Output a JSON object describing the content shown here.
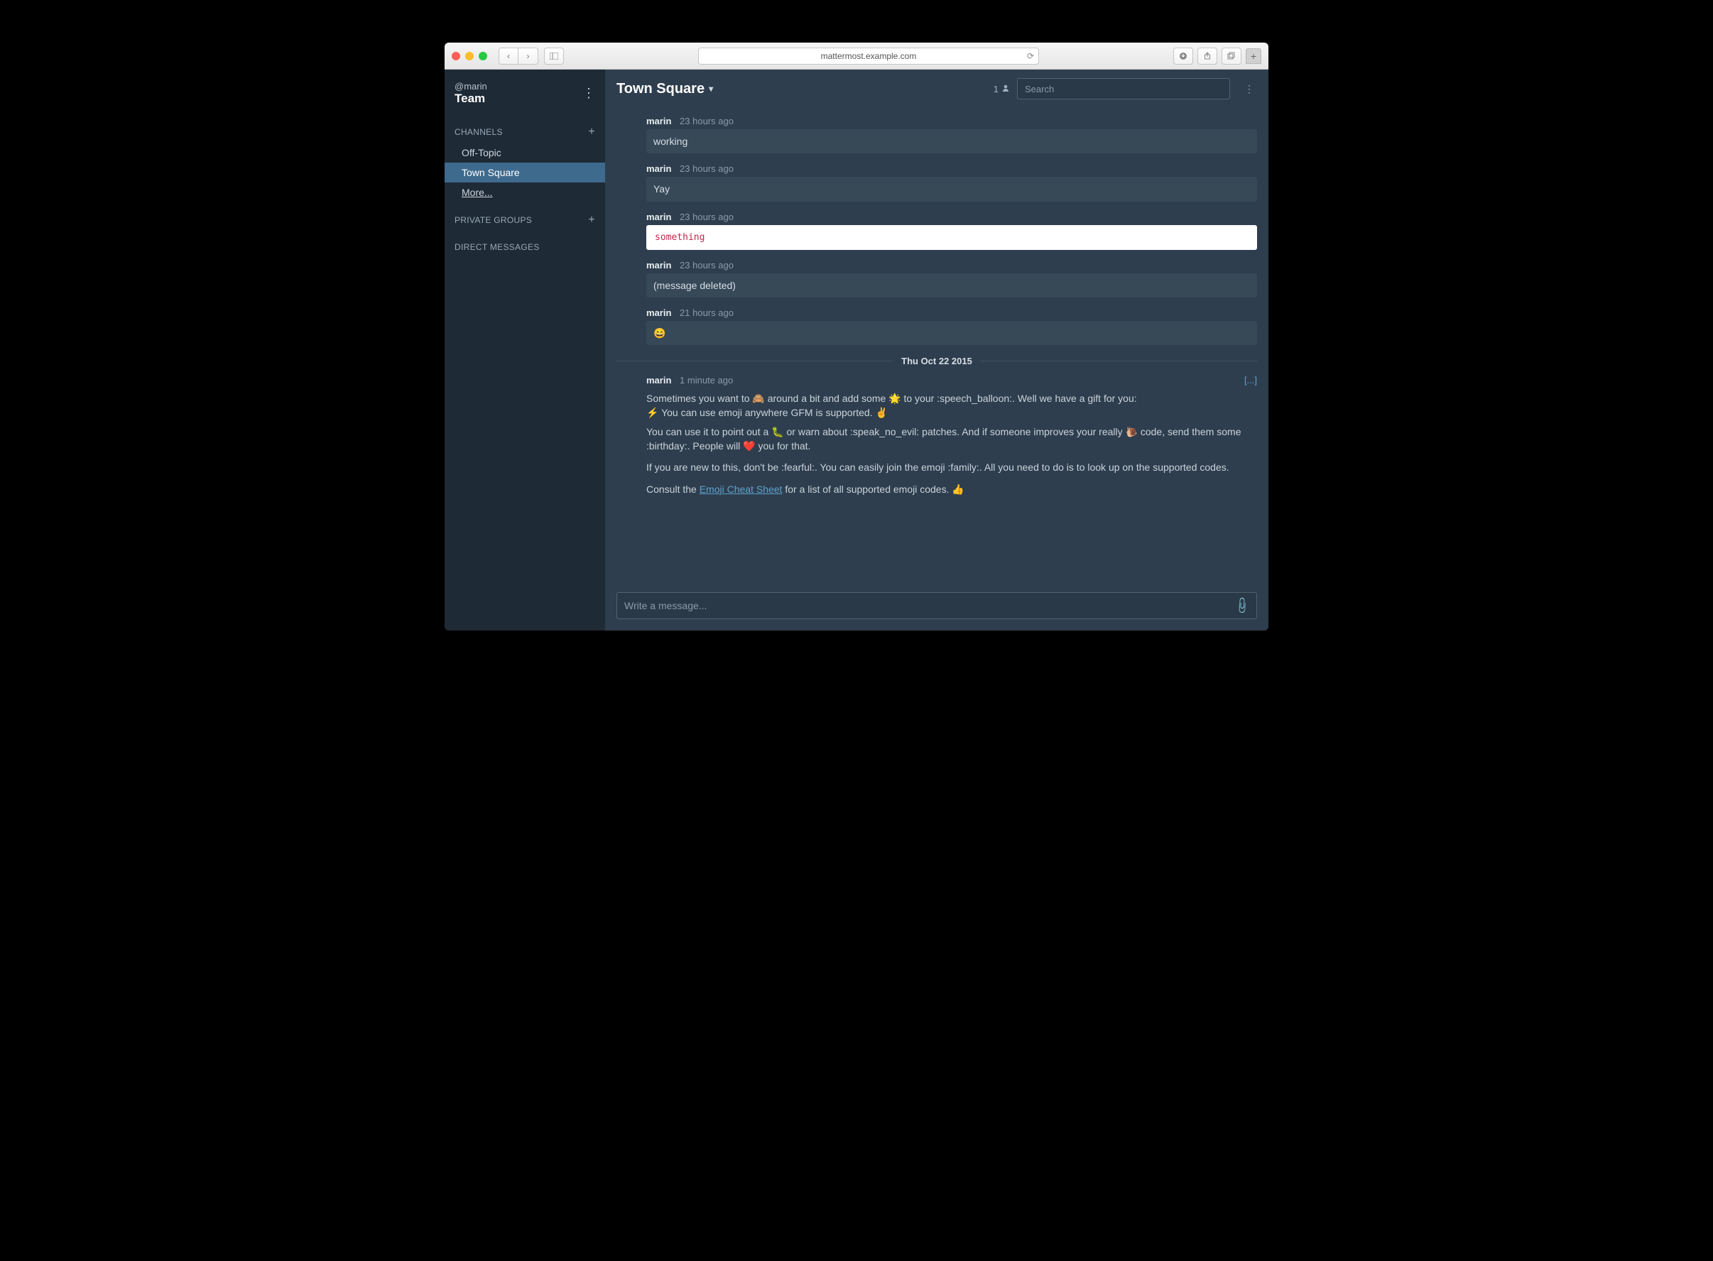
{
  "browser": {
    "url": "mattermost.example.com"
  },
  "sidebar": {
    "user": "@marin",
    "team": "Team",
    "sections": {
      "channels_label": "CHANNELS",
      "private_label": "PRIVATE GROUPS",
      "dm_label": "DIRECT MESSAGES"
    },
    "channels": [
      "Off-Topic",
      "Town Square",
      "More..."
    ],
    "active_channel": "Town Square"
  },
  "header": {
    "channel_title": "Town Square",
    "member_count": "1",
    "search_placeholder": "Search"
  },
  "date_separator": "Thu Oct 22 2015",
  "posts": [
    {
      "user": "marin",
      "time": "23 hours ago",
      "body": "working",
      "kind": "plain"
    },
    {
      "user": "marin",
      "time": "23 hours ago",
      "body": "Yay",
      "kind": "plain"
    },
    {
      "user": "marin",
      "time": "23 hours ago",
      "body": "something",
      "kind": "code"
    },
    {
      "user": "marin",
      "time": "23 hours ago",
      "body": "(message deleted)",
      "kind": "plain"
    },
    {
      "user": "marin",
      "time": "21 hours ago",
      "body": "😄",
      "kind": "plain"
    }
  ],
  "long_post": {
    "user": "marin",
    "time": "1 minute ago",
    "collapse": "[...]",
    "para1": "Sometimes you want to 🙈 around a bit and add some 🌟 to your :speech_balloon:. Well we have a gift for you:",
    "para2": "⚡ You can use emoji anywhere GFM is supported. ✌️",
    "para3": "You can use it to point out a 🐛 or warn about :speak_no_evil: patches. And if someone improves your really 🐌 code, send them some :birthday:. People will ❤️ you for that.",
    "para4": "If you are new to this, don't be :fearful:. You can easily join the emoji :family:. All you need to do is to look up on the supported codes.",
    "para5a": "Consult the ",
    "para5_link": "Emoji Cheat Sheet",
    "para5b": " for a list of all supported emoji codes. 👍"
  },
  "composer": {
    "placeholder": "Write a message..."
  }
}
